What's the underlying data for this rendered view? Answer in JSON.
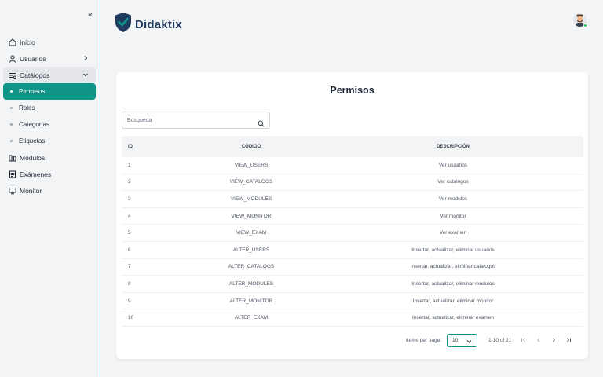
{
  "app": {
    "name": "Didaktix"
  },
  "sidebar": {
    "items": [
      {
        "label": "Inicio",
        "icon": "home-icon"
      },
      {
        "label": "Usuarios",
        "icon": "user-icon"
      },
      {
        "label": "Catálogos",
        "icon": "catalog-icon"
      },
      {
        "label": "Módulos",
        "icon": "modules-icon"
      },
      {
        "label": "Exámenes",
        "icon": "exam-icon"
      },
      {
        "label": "Monitor",
        "icon": "monitor-icon"
      }
    ],
    "catalog_children": [
      {
        "label": "Permisos",
        "active": true
      },
      {
        "label": "Roles"
      },
      {
        "label": "Categorías"
      },
      {
        "label": "Etiquetas"
      }
    ]
  },
  "page": {
    "title": "Permisos",
    "search_placeholder": "Búsqueda"
  },
  "table": {
    "headers": {
      "id": "ID",
      "code": "CÓDIGO",
      "description": "DESCRIPCIÓN"
    },
    "rows": [
      {
        "id": "1",
        "code": "VIEW_USERS",
        "description": "Ver usuarios"
      },
      {
        "id": "2",
        "code": "VIEW_CATALOGS",
        "description": "Ver catalogos"
      },
      {
        "id": "3",
        "code": "VIEW_MODULES",
        "description": "Ver modulos"
      },
      {
        "id": "4",
        "code": "VIEW_MONITOR",
        "description": "Ver monitor"
      },
      {
        "id": "5",
        "code": "VIEW_EXAM",
        "description": "Ver examen"
      },
      {
        "id": "6",
        "code": "ALTER_USERS",
        "description": "Insertar, actualizar, eliminar usuarios"
      },
      {
        "id": "7",
        "code": "ALTER_CATALOGS",
        "description": "Insertar, actualizar, eliminar catalogos"
      },
      {
        "id": "8",
        "code": "ALTER_MODULES",
        "description": "Insertar, actualizar, eliminar modulos"
      },
      {
        "id": "9",
        "code": "ALTER_MONITOR",
        "description": "Insertar, actualizar, eliminar monitor"
      },
      {
        "id": "10",
        "code": "ALTER_EXAM",
        "description": "Insertar, actualizar, eliminar examen"
      }
    ]
  },
  "pagination": {
    "items_per_page_label": "Items per page:",
    "items_per_page_value": "10",
    "range_label": "1-10 of 21"
  },
  "colors": {
    "accent": "#0f9488",
    "brand_dark": "#1e3a5f",
    "sidebar_border": "#5aa5b8"
  }
}
